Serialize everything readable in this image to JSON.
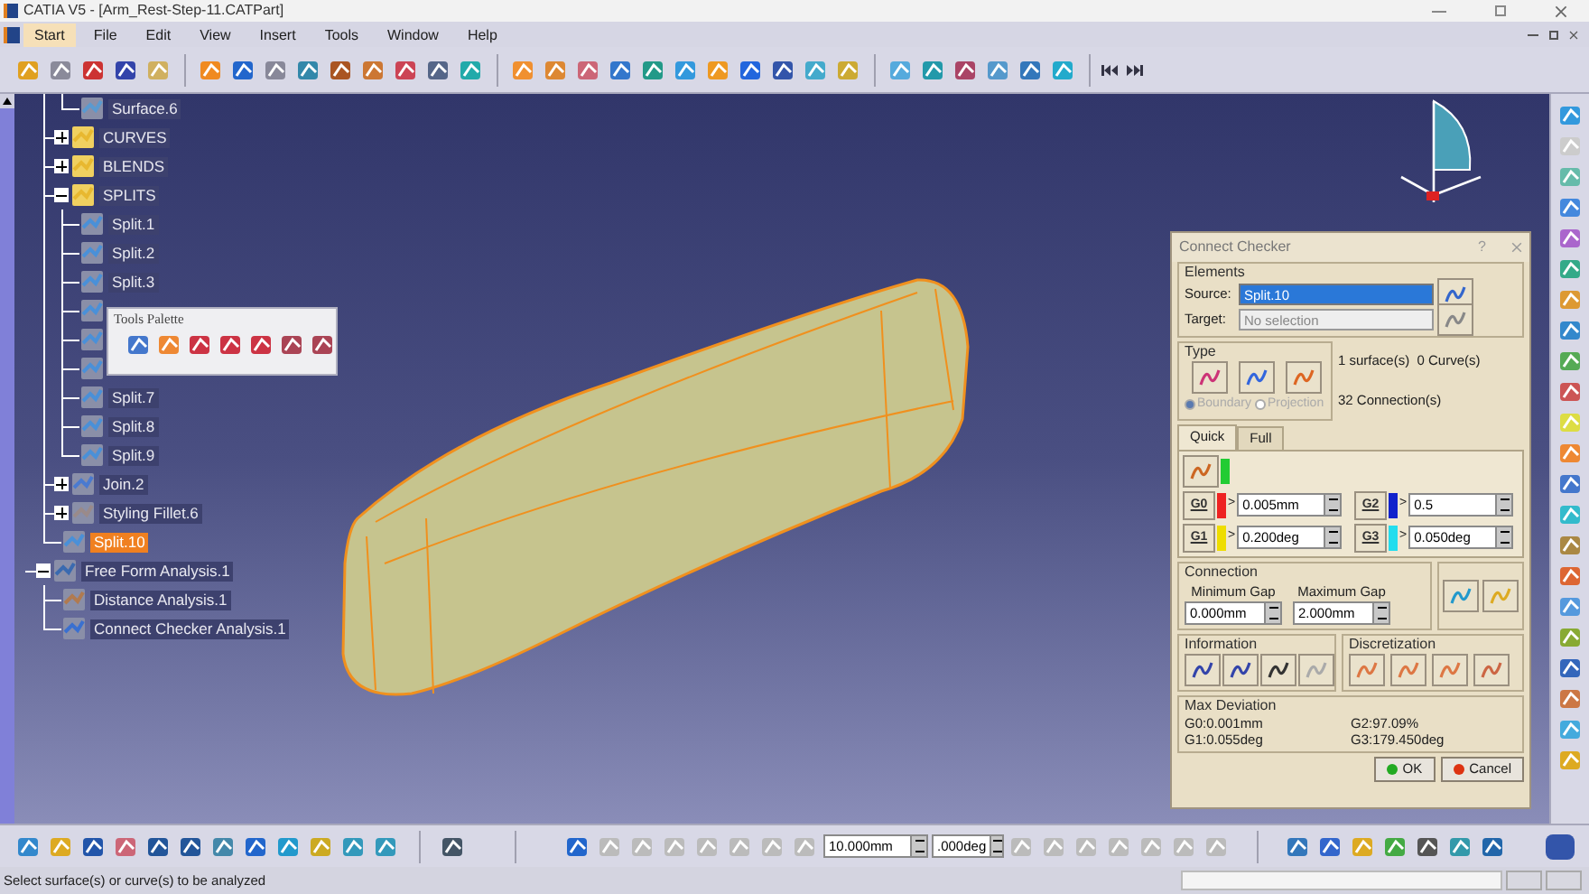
{
  "window": {
    "title": "CATIA V5 - [Arm_Rest-Step-11.CATPart]"
  },
  "menu": [
    {
      "label": "Start",
      "selected": true
    },
    {
      "label": "File",
      "selected": false
    },
    {
      "label": "Edit",
      "selected": false
    },
    {
      "label": "View",
      "selected": false
    },
    {
      "label": "Insert",
      "selected": false
    },
    {
      "label": "Tools",
      "selected": false
    },
    {
      "label": "Window",
      "selected": false
    },
    {
      "label": "Help",
      "selected": false
    }
  ],
  "tree": [
    {
      "kind": "body",
      "children": [
        {
          "kind": "branch",
          "children": [
            {
              "kind": "surface",
              "label": "Surface.6",
              "selected": false
            }
          ]
        },
        {
          "kind": "folder",
          "label": "CURVES",
          "expanded": false,
          "selected": false
        },
        {
          "kind": "folder",
          "label": "BLENDS",
          "expanded": false,
          "selected": false
        },
        {
          "kind": "folder",
          "label": "SPLITS",
          "expanded": true,
          "selected": false,
          "children": [
            {
              "kind": "split",
              "label": "Split.1",
              "selected": false
            },
            {
              "kind": "split",
              "label": "Split.2",
              "selected": false
            },
            {
              "kind": "split",
              "label": "Split.3",
              "selected": false
            },
            {
              "kind": "split"
            },
            {
              "kind": "split"
            },
            {
              "kind": "split"
            },
            {
              "kind": "split",
              "label": "Split.7",
              "selected": false
            },
            {
              "kind": "split",
              "label": "Split.8",
              "selected": false
            },
            {
              "kind": "split",
              "label": "Split.9",
              "selected": false
            }
          ]
        },
        {
          "kind": "join",
          "label": "Join.2",
          "expanded": false,
          "selected": false
        },
        {
          "kind": "fillet",
          "label": "Styling Fillet.6",
          "expanded": false,
          "selected": false
        },
        {
          "kind": "split",
          "label": "Split.10",
          "selected": true
        }
      ]
    },
    {
      "kind": "analysis",
      "label": "Free Form Analysis.1",
      "expanded": true,
      "selected": false,
      "children": [
        {
          "kind": "distance",
          "label": "Distance Analysis.1",
          "selected": false
        },
        {
          "kind": "checker",
          "label": "Connect Checker Analysis.1",
          "selected": false
        }
      ]
    }
  ],
  "tools_palette": {
    "title": "Tools Palette"
  },
  "connect_checker": {
    "title": "Connect Checker",
    "help": "?",
    "elements": {
      "title": "Elements",
      "source_label": "Source:",
      "source": "Split.10",
      "target_label": "Target:",
      "target_placeholder": "No selection"
    },
    "type": {
      "title": "Type",
      "options": [
        {
          "label": "Boundary",
          "selected": true,
          "disabled": true
        },
        {
          "label": "Projection",
          "selected": false,
          "disabled": true
        }
      ]
    },
    "summary": [
      "1 surface(s)  0 Curve(s)",
      "32 Connection(s)"
    ],
    "tabs": [
      {
        "label": "Quick",
        "selected": true
      },
      {
        "label": "Full",
        "selected": false
      }
    ],
    "overlap": {
      "color": "#22cc33"
    },
    "thresholds": [
      {
        "label": "G0",
        "color": "#ee2222",
        "comparator": ">",
        "value": "0.005mm"
      },
      {
        "label": "G2",
        "color": "#1122cc",
        "comparator": ">",
        "value": "0.5"
      },
      {
        "label": "G1",
        "color": "#eedd00",
        "comparator": ">",
        "value": "0.200deg"
      },
      {
        "label": "G3",
        "color": "#22ddee",
        "comparator": ">",
        "value": "0.050deg"
      }
    ],
    "connection": {
      "title": "Connection",
      "min_label": "Minimum Gap",
      "min": "0.000mm",
      "max_label": "Maximum Gap",
      "max": "2.000mm"
    },
    "information_title": "Information",
    "discretization_title": "Discretization",
    "max_deviation": {
      "title": "Max Deviation",
      "values": [
        "G0:0.001mm",
        "G2:97.09%",
        "G1:0.055deg",
        "G3:179.450deg"
      ]
    },
    "buttons": [
      {
        "label": "OK",
        "kind": "ok"
      },
      {
        "label": "Cancel",
        "kind": "cancel"
      }
    ]
  },
  "bottom_toolbar": {
    "step": "10.000mm",
    "angle": ".000deg"
  },
  "status_bar": {
    "message": "Select surface(s) or curve(s) to be analyzed"
  }
}
